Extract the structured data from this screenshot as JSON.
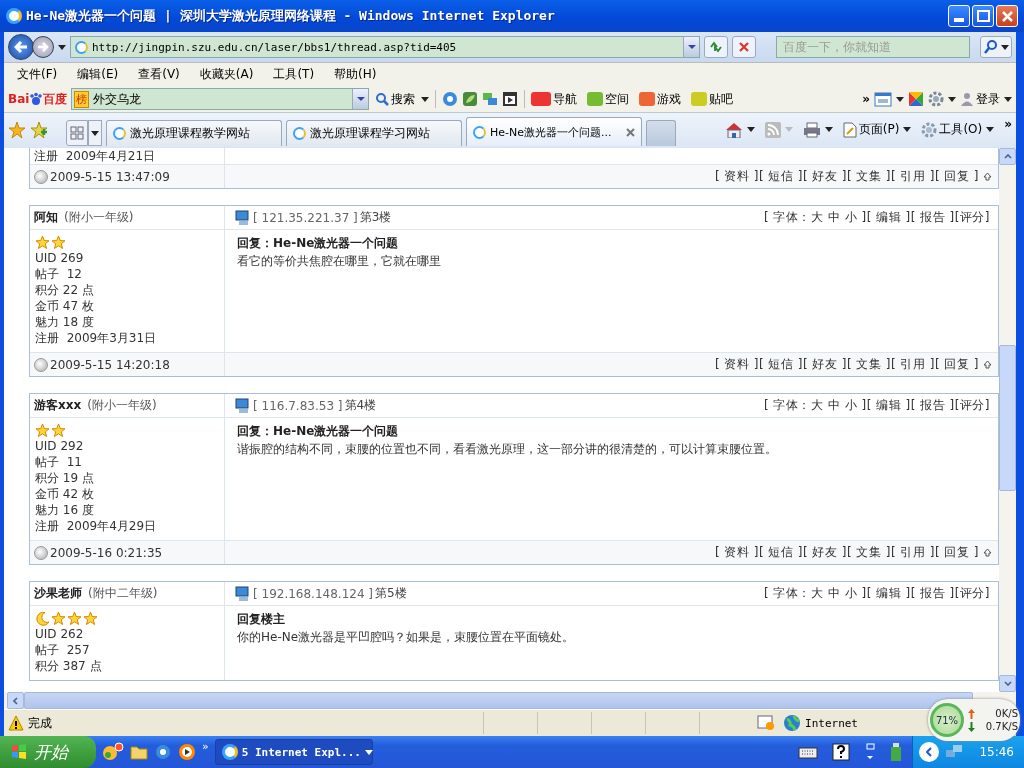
{
  "window": {
    "title": "He-Ne激光器一个问题 | 深圳大学激光原理网络课程 - Windows Internet Explorer"
  },
  "address_bar": {
    "url": "http://jingpin.szu.edu.cn/laser/bbs1/thread.asp?tid=405",
    "search_placeholder": "百度一下，你就知道"
  },
  "menu": [
    "文件(F)",
    "编辑(E)",
    "查看(V)",
    "收藏夹(A)",
    "工具(T)",
    "帮助(H)"
  ],
  "baidu_toolbar": {
    "logo": [
      "Bai",
      "百度"
    ],
    "badge": "榜",
    "search_value": "外交乌龙",
    "search_button": "搜索",
    "links": [
      "导航",
      "空间",
      "游戏",
      "贴吧"
    ],
    "more": "»",
    "login": "登录"
  },
  "tabs": [
    {
      "label": "激光原理课程教学网站",
      "selected": false
    },
    {
      "label": "激光原理课程学习网站",
      "selected": false
    },
    {
      "label": "He-Ne激光器一个问题...",
      "selected": true
    }
  ],
  "command_bar": {
    "page": "页面(P)",
    "tools": "工具(O)",
    "more": "»"
  },
  "top_post": {
    "profile_tail": "注册  2009年4月21日",
    "time": "2009-5-15 13:47:09",
    "footer_links": [
      "[ 资料 ]",
      "[ 短信 ]",
      "[ 好友 ]",
      "[ 文集 ]",
      "[ 引用 ]",
      "[ 回复 ]"
    ]
  },
  "posts": [
    {
      "author": "阿知",
      "grade": "(附小一年级)",
      "ip": "[ 121.35.221.37 ]",
      "floor": "第3楼",
      "header_links": [
        "[ 字体：大 中 小 ]",
        "[ 编辑 ]",
        "[ 报告 ]",
        "[评分]"
      ],
      "rank": [
        {
          "kind": "star"
        },
        {
          "kind": "star"
        }
      ],
      "profile": [
        "UID 269",
        "帖子  12",
        "积分 22 点",
        "金币 47 枚",
        "魅力 18 度",
        "注册  2009年3月31日"
      ],
      "title": "回复：He-Ne激光器一个问题",
      "body": "看它的等价共焦腔在哪里，它就在哪里",
      "time": "2009-5-15 14:20:18",
      "footer_links": [
        "[ 资料 ]",
        "[ 短信 ]",
        "[ 好友 ]",
        "[ 文集 ]",
        "[ 引用 ]",
        "[ 回复 ]"
      ]
    },
    {
      "author": "游客xxx",
      "grade": "(附小一年级)",
      "ip": "[ 116.7.83.53 ]",
      "floor": "第4楼",
      "header_links": [
        "[ 字体：大 中 小 ]",
        "[ 编辑 ]",
        "[ 报告 ]",
        "[评分]"
      ],
      "rank": [
        {
          "kind": "star"
        },
        {
          "kind": "star"
        }
      ],
      "profile": [
        "UID 292",
        "帖子  11",
        "积分 19 点",
        "金币 42 枚",
        "魅力 16 度",
        "注册  2009年4月29日"
      ],
      "title": "回复：He-Ne激光器一个问题",
      "body": "谐振腔的结构不同，束腰的位置也不同，看看激光原理，这一部分讲的很清楚的，可以计算束腰位置。",
      "time": "2009-5-16 0:21:35",
      "footer_links": [
        "[ 资料 ]",
        "[ 短信 ]",
        "[ 好友 ]",
        "[ 文集 ]",
        "[ 引用 ]",
        "[ 回复 ]"
      ]
    },
    {
      "author": "沙果老师",
      "grade": "(附中二年级)",
      "ip": "[ 192.168.148.124 ]",
      "floor": "第5楼",
      "header_links": [
        "[ 字体：大 中 小 ]",
        "[ 编辑 ]",
        "[ 报告 ]",
        "[评分]"
      ],
      "rank": [
        {
          "kind": "moon"
        },
        {
          "kind": "star"
        },
        {
          "kind": "star"
        },
        {
          "kind": "star"
        }
      ],
      "profile": [
        "UID 262",
        "帖子  257",
        "积分 387 点"
      ],
      "title": "回复楼主",
      "body": "你的He-Ne激光器是平凹腔吗？如果是，束腰位置在平面镜处。"
    }
  ],
  "status_bar": {
    "text": "完成",
    "zone": "Internet"
  },
  "net_meter": {
    "percent": "71%",
    "up": "0K/S",
    "down": "0.7K/S"
  },
  "taskbar": {
    "start": "开始",
    "more": "»",
    "task": "5 Internet Expl...",
    "clock": "15:46"
  }
}
